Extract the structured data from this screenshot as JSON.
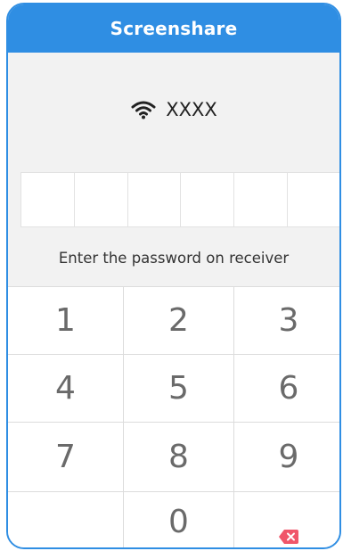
{
  "header": {
    "title": "Screenshare"
  },
  "network": {
    "icon": "wifi-icon",
    "name": "XXXX"
  },
  "pin": {
    "box_count": 6,
    "values": [
      "",
      "",
      "",
      "",
      "",
      ""
    ]
  },
  "instruction": "Enter the password on receiver",
  "keypad": {
    "keys": [
      "1",
      "2",
      "3",
      "4",
      "5",
      "6",
      "7",
      "8",
      "9",
      "",
      "0",
      "backspace-icon"
    ]
  },
  "colors": {
    "accent": "#2f8ee3",
    "background": "#f2f2f2",
    "backspace": "#f0566a"
  }
}
